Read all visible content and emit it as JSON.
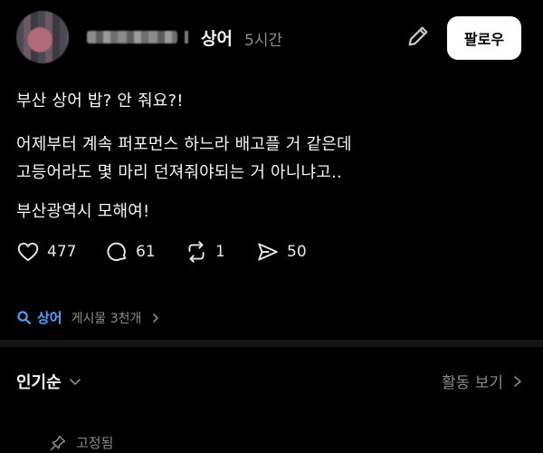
{
  "header": {
    "topic": "상어",
    "time": "5시간",
    "follow_label": "팔로우"
  },
  "post": {
    "lines": [
      "부산 상어 밥? 안 줘요?!",
      "어제부터 계속 퍼포먼스 하느라 배고플 거 같은데",
      "고등어라도 몇 마리 던져줘야되는 거 아니냐고..",
      "부산광역시 모해여!"
    ]
  },
  "actions": {
    "likes": "477",
    "replies": "61",
    "reposts": "1",
    "shares": "50"
  },
  "topic_row": {
    "name": "상어",
    "count": "게시물 3천개"
  },
  "sort": {
    "label": "인기순"
  },
  "activity": {
    "label": "활동 보기"
  },
  "pinned": {
    "label": "고정됨"
  },
  "colors": {
    "background": "#000000",
    "accent_link": "#4aa3ff",
    "muted": "#8a8a8f",
    "follow_bg": "#ffffff"
  },
  "icons": [
    "edit-icon",
    "heart-icon",
    "comment-icon",
    "repost-icon",
    "share-icon",
    "search-icon",
    "chevron-right-icon",
    "chevron-down-icon",
    "pin-icon"
  ]
}
